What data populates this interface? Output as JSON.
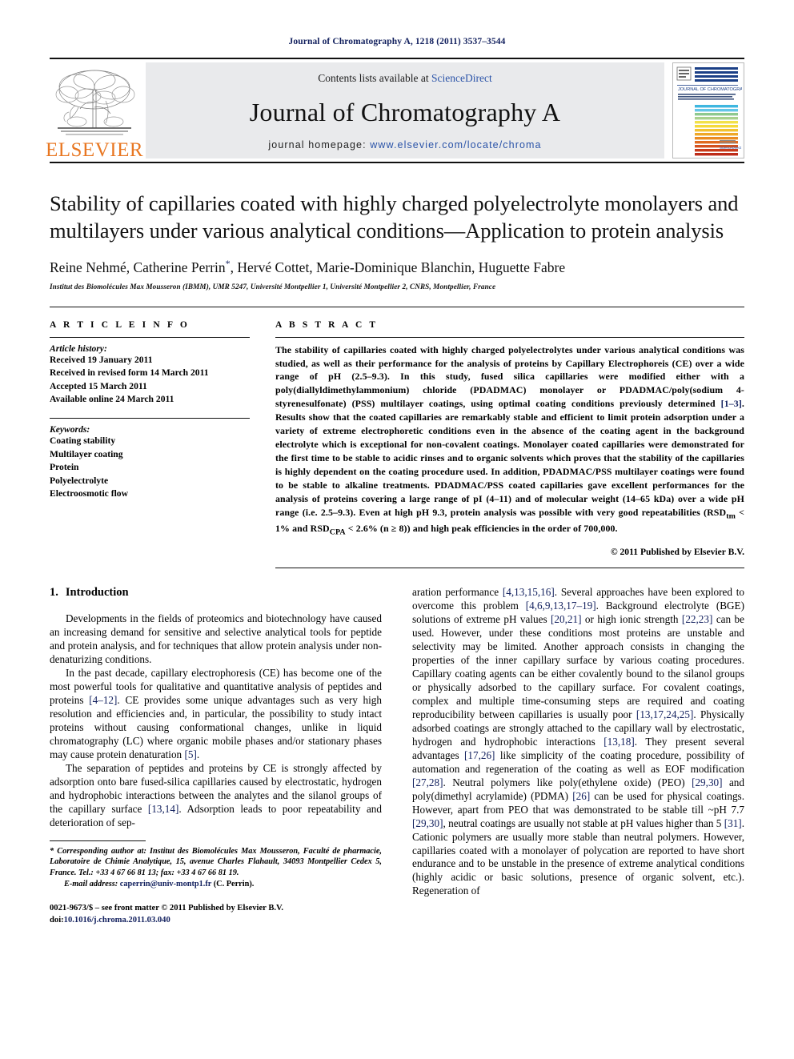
{
  "running_head": "Journal of Chromatography A, 1218 (2011) 3537–3544",
  "masthead": {
    "publisher": "ELSEVIER",
    "contents_prefix": "Contents lists available at ",
    "contents_link": "ScienceDirect",
    "journal_title": "Journal of Chromatography A",
    "homepage_prefix": "journal  homepage:  ",
    "homepage_url": "www.elsevier.com/locate/chroma",
    "cover_title": "JOURNAL OF CHROMATOGRAPHY A",
    "cover_subtitle": "INCLUDING ELECTROPHORESIS AND OTHER SEPARATION METHODS  •  BIOMEDICAL AND BIOLOGICAL APPLICATIONS",
    "cover_footer": "Available online at\nScienceDirect"
  },
  "article": {
    "title": "Stability of capillaries coated with highly charged polyelectrolyte monolayers and multilayers under various analytical conditions—Application to protein analysis",
    "authors": "Reine Nehmé, Catherine Perrin*, Hervé Cottet, Marie-Dominique Blanchin, Huguette Fabre",
    "affiliation": "Institut des Biomolécules Max Mousseron (IBMM), UMR 5247, Université Montpellier 1, Université Montpellier 2, CNRS, Montpellier, France"
  },
  "article_info": {
    "section_label": "A R T I C L E   I N F O",
    "history_heading": "Article history:",
    "history": [
      "Received 19 January 2011",
      "Received in revised form 14 March 2011",
      "Accepted 15 March 2011",
      "Available online 24 March 2011"
    ],
    "keywords_heading": "Keywords:",
    "keywords": [
      "Coating stability",
      "Multilayer coating",
      "Protein",
      "Polyelectrolyte",
      "Electroosmotic flow"
    ]
  },
  "abstract": {
    "section_label": "A B S T R A C T",
    "text_part1": "The stability of capillaries coated with highly charged polyelectrolytes under various analytical conditions was studied, as well as their performance for the analysis of proteins by Capillary Electrophoreis (CE) over a wide range of pH (2.5–9.3). In this study, fused silica capillaries were modified either with a poly(diallyldimethylammonium) chloride (PDADMAC) monolayer or PDADMAC/poly(sodium 4-styrenesulfonate) (PSS) multilayer coatings, using optimal coating conditions previously determined ",
    "ref1": "[1–3]",
    "text_part2": ". Results show that the coated capillaries are remarkably stable and efficient to limit protein adsorption under a variety of extreme electrophoretic conditions even in the absence of the coating agent in the background electrolyte which is exceptional for non-covalent coatings. Monolayer coated capillaries were demonstrated for the first time to be stable to acidic rinses and to organic solvents which proves that the stability of the capillaries is highly dependent on the coating procedure used. In addition, PDADMAC/PSS multilayer coatings were found to be stable to alkaline treatments. PDADMAC/PSS coated capillaries gave excellent performances for the analysis of proteins covering a large range of pI (4–11) and of molecular weight (14–65 kDa) over a wide pH range (i.e. 2.5–9.3). Even at high pH 9.3, protein analysis was possible with very good repeatabilities (RSD",
    "sub1": "tm",
    "text_part3": " < 1% and RSD",
    "sub2": "CPA",
    "text_part4": " < 2.6% (n ≥ 8)) and high peak efficiencies in the order of 700,000.",
    "copyright": "© 2011 Published by Elsevier B.V."
  },
  "introduction": {
    "heading_number": "1.",
    "heading_text": "Introduction",
    "left_paragraphs": [
      {
        "segments": [
          {
            "t": "Developments in the fields of proteomics and biotechnology have caused an increasing demand for sensitive and selective analytical tools for peptide and protein analysis, and for techniques that allow protein analysis under non-denaturizing conditions."
          }
        ]
      },
      {
        "segments": [
          {
            "t": "In the past decade, capillary electrophoresis (CE) has become one of the most powerful tools for qualitative and quantitative analysis of peptides and proteins "
          },
          {
            "t": "[4–12]",
            "ref": true
          },
          {
            "t": ". CE provides some unique advantages such as very high resolution and efficiencies and, in particular, the possibility to study intact proteins without causing conformational changes, unlike in liquid chromatography (LC) where organic mobile phases and/or stationary phases may cause protein denaturation "
          },
          {
            "t": "[5]",
            "ref": true
          },
          {
            "t": "."
          }
        ]
      },
      {
        "segments": [
          {
            "t": "The separation of peptides and proteins by CE is strongly affected by adsorption onto bare fused-silica capillaries caused by electrostatic, hydrogen and hydrophobic interactions between the analytes and the silanol groups of the capillary surface "
          },
          {
            "t": "[13,14]",
            "ref": true
          },
          {
            "t": ". Adsorption leads to poor repeatability and deterioration of sep-"
          }
        ]
      }
    ],
    "right_paragraphs": [
      {
        "indent": false,
        "segments": [
          {
            "t": "aration performance "
          },
          {
            "t": "[4,13,15,16]",
            "ref": true
          },
          {
            "t": ". Several approaches have been explored to overcome this problem "
          },
          {
            "t": "[4,6,9,13,17–19]",
            "ref": true
          },
          {
            "t": ". Background electrolyte (BGE) solutions of extreme pH values "
          },
          {
            "t": "[20,21]",
            "ref": true
          },
          {
            "t": " or high ionic strength "
          },
          {
            "t": "[22,23]",
            "ref": true
          },
          {
            "t": " can be used. However, under these conditions most proteins are unstable and selectivity may be limited. Another approach consists in changing the properties of the inner capillary surface by various coating procedures. Capillary coating agents can be either covalently bound to the silanol groups or physically adsorbed to the capillary surface. For covalent coatings, complex and multiple time-consuming steps are required and coating reproducibility between capillaries is usually poor "
          },
          {
            "t": "[13,17,24,25]",
            "ref": true
          },
          {
            "t": ". Physically adsorbed coatings are strongly attached to the capillary wall by electrostatic, hydrogen and hydrophobic interactions "
          },
          {
            "t": "[13,18]",
            "ref": true
          },
          {
            "t": ". They present several advantages "
          },
          {
            "t": "[17,26]",
            "ref": true
          },
          {
            "t": " like simplicity of the coating procedure, possibility of automation and regeneration of the coating as well as EOF modification "
          },
          {
            "t": "[27,28]",
            "ref": true
          },
          {
            "t": ". Neutral polymers like poly(ethylene oxide) (PEO) "
          },
          {
            "t": "[29,30]",
            "ref": true
          },
          {
            "t": " and poly(dimethyl acrylamide) (PDMA) "
          },
          {
            "t": "[26]",
            "ref": true
          },
          {
            "t": " can be used for physical coatings. However, apart from PEO that was demonstrated to be stable till ~pH 7.7 "
          },
          {
            "t": "[29,30]",
            "ref": true
          },
          {
            "t": ", neutral coatings are usually not stable at pH values higher than 5 "
          },
          {
            "t": "[31]",
            "ref": true
          },
          {
            "t": ". Cationic polymers are usually more stable than neutral polymers. However, capillaries coated with a monolayer of polycation are reported to have short endurance and to be unstable in the presence of extreme analytical conditions (highly acidic or basic solutions, presence of organic solvent, etc.). Regeneration of"
          }
        ]
      }
    ]
  },
  "footnotes": {
    "corresponding": "* Corresponding author at: Institut des Biomolécules Max Mousseron, Faculté de pharmacie, Laboratoire de Chimie Analytique, 15, avenue Charles Flahault, 34093 Montpellier Cedex 5, France. Tel.: +33 4 67 66 81 13; fax: +33 4 67 66 81 19.",
    "email_label": "E-mail address:",
    "email": "caperrin@univ-montp1.fr",
    "email_suffix": " (C. Perrin).",
    "front_matter": "0021-9673/$ – see front matter © 2011 Published by Elsevier B.V.",
    "doi_label": "doi:",
    "doi": "10.1016/j.chroma.2011.03.040"
  },
  "colors": {
    "link": "#2a53a8",
    "ref": "#12205e",
    "elsevier_orange": "#e87722",
    "masthead_bg": "#e9eaec"
  }
}
